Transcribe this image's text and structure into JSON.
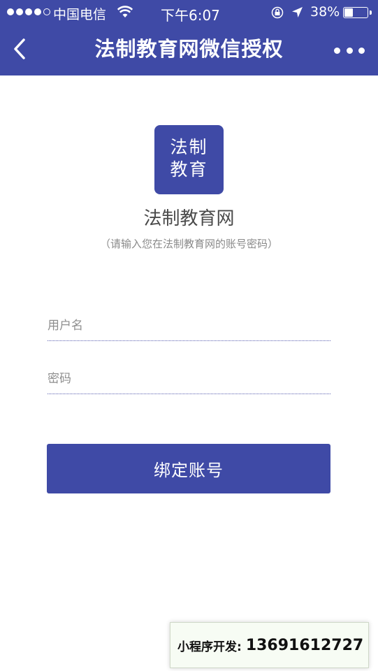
{
  "status_bar": {
    "carrier": "中国电信",
    "time": "下午6:07",
    "battery": "38%",
    "battery_level": 0.38
  },
  "nav": {
    "title": "法制教育网微信授权",
    "back_icon": "chevron-left-icon",
    "more_icon": "more-dots-icon"
  },
  "brand": {
    "logo_line1": "法制",
    "logo_line2": "教育",
    "name": "法制教育网",
    "subtitle": "（请输入您在法制教育网的账号密码）",
    "accent_color": "#3f4aa6"
  },
  "form": {
    "username_placeholder": "用户名",
    "username_value": "",
    "password_placeholder": "密码",
    "password_value": "",
    "submit_label": "绑定账号"
  },
  "watermark": {
    "label": "小程序开发:",
    "phone": "13691612727"
  }
}
